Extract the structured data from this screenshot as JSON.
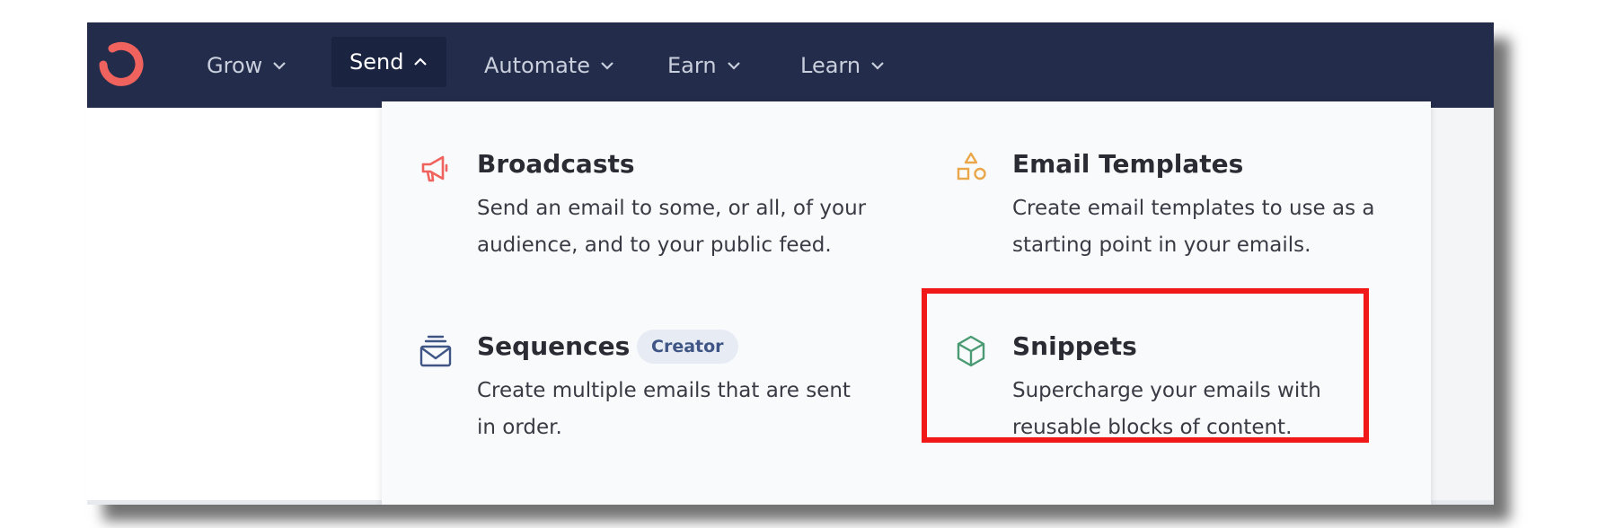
{
  "nav": {
    "items": [
      {
        "label": "Grow",
        "icon": "chevron-down-icon"
      },
      {
        "label": "Send",
        "icon": "chevron-up-icon",
        "active": true
      },
      {
        "label": "Automate",
        "icon": "chevron-down-icon"
      },
      {
        "label": "Earn",
        "icon": "chevron-down-icon"
      },
      {
        "label": "Learn",
        "icon": "chevron-down-icon"
      }
    ]
  },
  "dropdown": {
    "items": [
      {
        "title": "Broadcasts",
        "description": "Send an email to some, or all, of your audience, and to your public feed.",
        "icon": "megaphone-icon"
      },
      {
        "title": "Email Templates",
        "description": "Create email templates to use as a starting point in your emails.",
        "icon": "shapes-icon"
      },
      {
        "title": "Sequences",
        "badge": "Creator",
        "description": "Create multiple emails that are sent in order.",
        "icon": "envelope-stack-icon"
      },
      {
        "title": "Snippets",
        "description": "Supercharge your emails with reusable blocks of content.",
        "icon": "cube-icon"
      }
    ]
  },
  "colors": {
    "navbar": "#232d4b",
    "brand": "#f0625d",
    "highlight": "#f01818",
    "badge_bg": "#e6ebf4",
    "badge_text": "#3e5586"
  }
}
